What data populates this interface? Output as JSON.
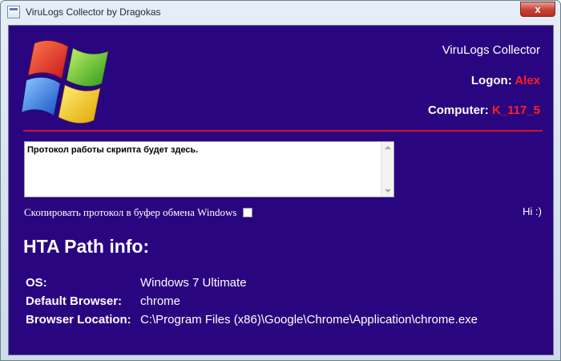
{
  "window": {
    "title": "ViruLogs Collector by Dragokas",
    "close_label": "x"
  },
  "header": {
    "app_name": "ViruLogs Collector",
    "logon_label": "Logon: ",
    "logon_value": "Alex",
    "computer_label": "Computer: ",
    "computer_value": "K_117_5"
  },
  "log": {
    "text": "Протокол работы скрипта будет здесь."
  },
  "copy_option": {
    "label": "Скопировать протокол в буфер обмена Windows",
    "checked": false
  },
  "greeting": "Hi :)",
  "hta_info": {
    "heading": "HTA Path info:",
    "rows": [
      {
        "label": "OS:",
        "value": "Windows 7 Ultimate"
      },
      {
        "label": "Default Browser:",
        "value": "chrome"
      },
      {
        "label": "Browser Location:",
        "value": "C:\\Program Files (x86)\\Google\\Chrome\\Application\\chrome.exe"
      }
    ]
  },
  "colors": {
    "background": "#2a0580",
    "accent_red": "#ff2020",
    "divider": "#d0132a"
  },
  "icons": {
    "logo": "windows-logo-icon",
    "app": "app-icon"
  }
}
